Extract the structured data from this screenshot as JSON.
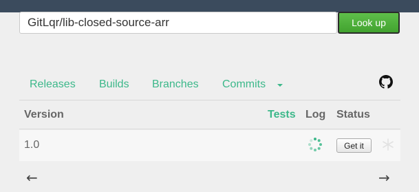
{
  "search": {
    "value": "GitLqr/lib-closed-source-arr",
    "button_label": "Look up"
  },
  "tabs": [
    {
      "label": "Releases"
    },
    {
      "label": "Builds"
    },
    {
      "label": "Branches"
    },
    {
      "label": "Commits"
    }
  ],
  "table": {
    "headers": {
      "version": "Version",
      "tests": "Tests",
      "log": "Log",
      "status": "Status"
    },
    "rows": [
      {
        "version": "1.0",
        "action_label": "Get it"
      }
    ]
  },
  "pager": {
    "prev": "←",
    "next": "→"
  },
  "icons": {
    "repo": "github-icon",
    "log": "loading-spinner-icon",
    "status": "snowflake-icon",
    "commits_menu": "caret-down-icon"
  },
  "colors": {
    "topbar": "#3b4b5d",
    "accent": "#3cb88a",
    "button": "#4caf3a"
  }
}
